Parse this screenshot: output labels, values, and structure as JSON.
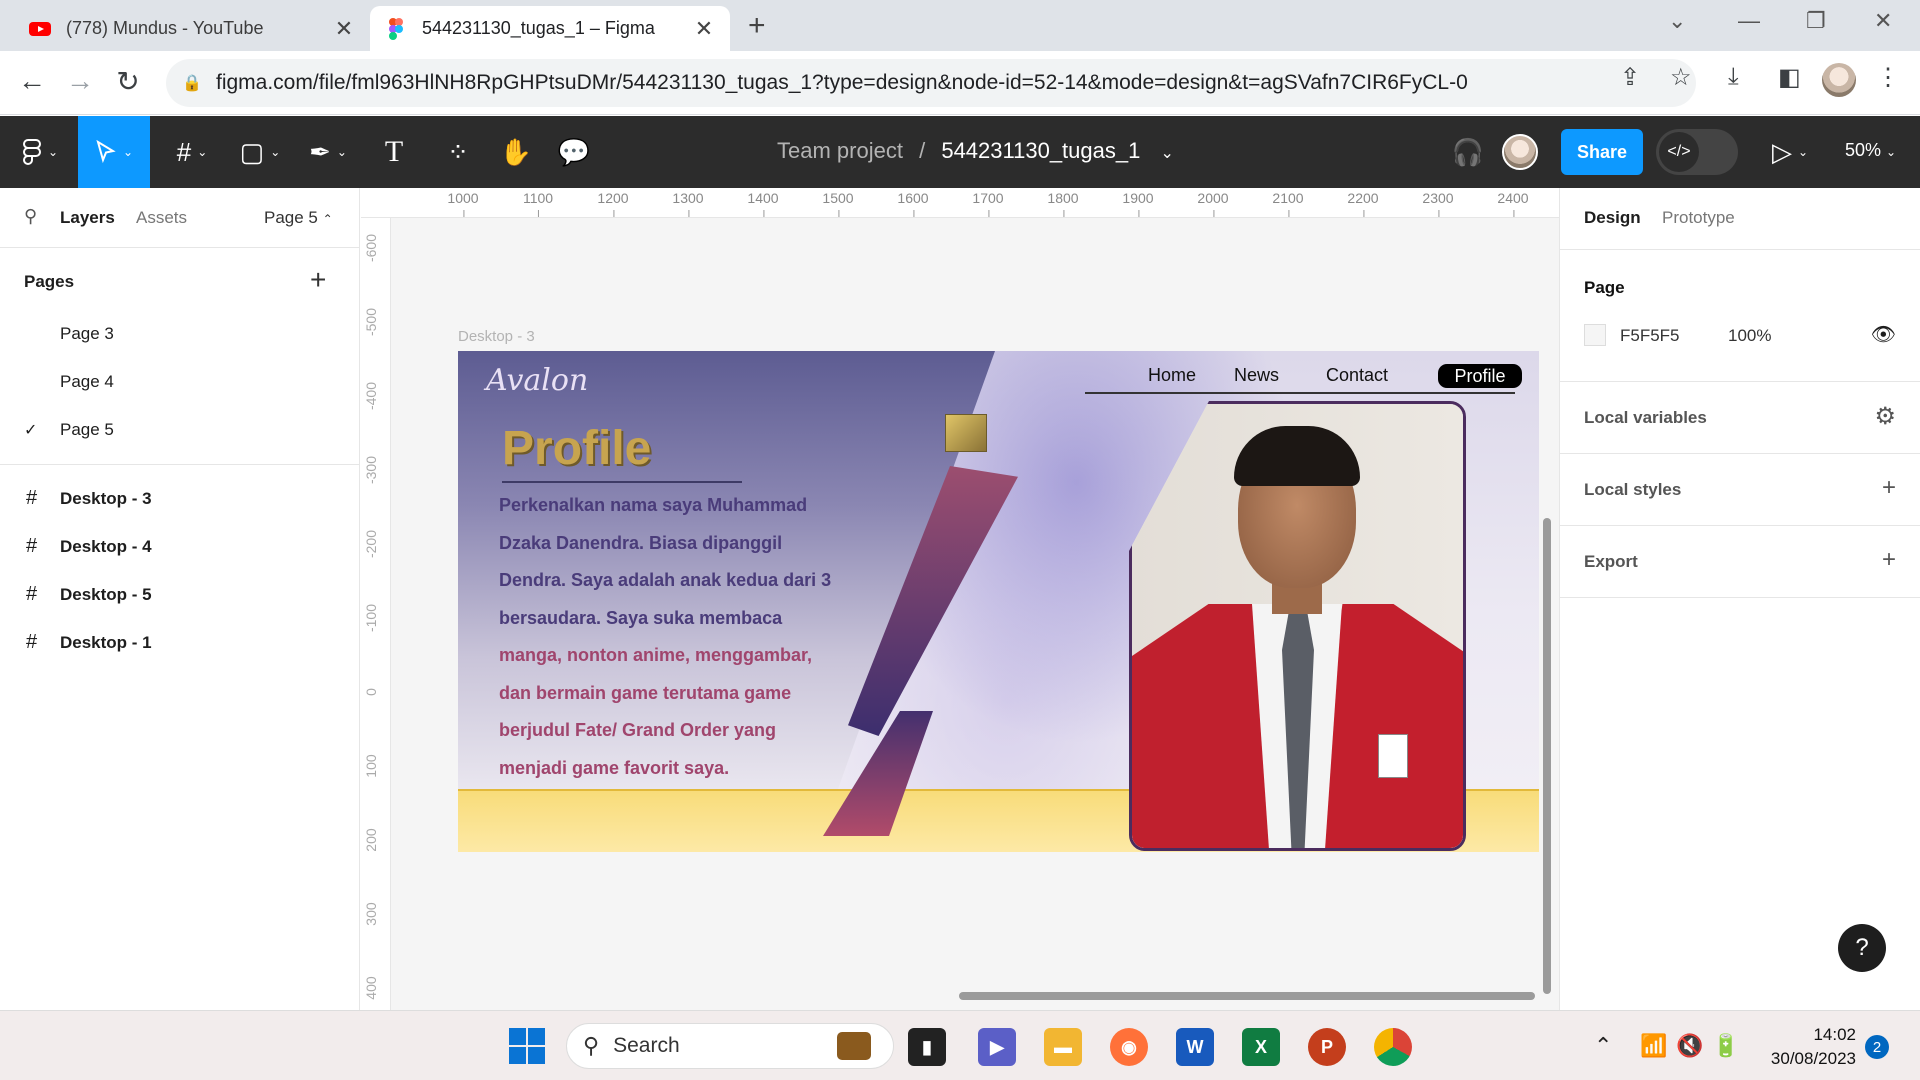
{
  "browser": {
    "tabs": [
      {
        "title": "(778) Mundus - YouTube",
        "icon": "youtube-icon",
        "active": false
      },
      {
        "title": "544231130_tugas_1 – Figma",
        "icon": "figma-icon",
        "active": true
      }
    ],
    "url": "figma.com/file/fml963HlNH8RpGHPtsuDMr/544231130_tugas_1?type=design&node-id=52-14&mode=design&t=agSVafn7CIR6FyCL-0"
  },
  "figma": {
    "breadcrumb": {
      "team": "Team project",
      "separator": "/",
      "file": "544231130_tugas_1"
    },
    "share_label": "Share",
    "zoom": "50%",
    "left_panel": {
      "tabs": [
        "Layers",
        "Assets"
      ],
      "current_page": "Page 5",
      "pages_title": "Pages",
      "pages": [
        {
          "label": "Page 3",
          "checked": false
        },
        {
          "label": "Page 4",
          "checked": false
        },
        {
          "label": "Page 5",
          "checked": true
        }
      ],
      "layers": [
        "Desktop - 3",
        "Desktop - 4",
        "Desktop - 5",
        "Desktop - 1"
      ]
    },
    "rulers": {
      "horizontal": [
        "1000",
        "1100",
        "1200",
        "1300",
        "1400",
        "1500",
        "1600",
        "1700",
        "1800",
        "1900",
        "2000",
        "2100",
        "2200",
        "2300",
        "2400"
      ],
      "vertical": [
        "-600",
        "-500",
        "-400",
        "-300",
        "-200",
        "-100",
        "0",
        "100",
        "200",
        "300",
        "400"
      ]
    },
    "frame": {
      "label": "Desktop - 3",
      "logo": "Avalon",
      "title": "Profile",
      "nav": [
        "Home",
        "News",
        "Contact",
        "Profile"
      ],
      "bio_lines": [
        "Perkenalkan nama saya Muhammad",
        "Dzaka Danendra. Biasa dipanggil",
        "Dendra. Saya adalah anak kedua dari 3",
        "bersaudara. Saya suka membaca",
        "manga, nonton anime, menggambar,",
        "dan bermain game terutama game",
        "berjudul Fate/ Grand Order yang",
        "menjadi game favorit saya."
      ]
    },
    "right_panel": {
      "tabs": [
        "Design",
        "Prototype"
      ],
      "page_section": "Page",
      "bg_hex": "F5F5F5",
      "bg_opacity": "100%",
      "sections": [
        "Local variables",
        "Local styles",
        "Export"
      ]
    },
    "help_label": "?"
  },
  "taskbar": {
    "search_placeholder": "Search",
    "time": "14:02",
    "date": "30/08/2023",
    "notifications": "2"
  }
}
